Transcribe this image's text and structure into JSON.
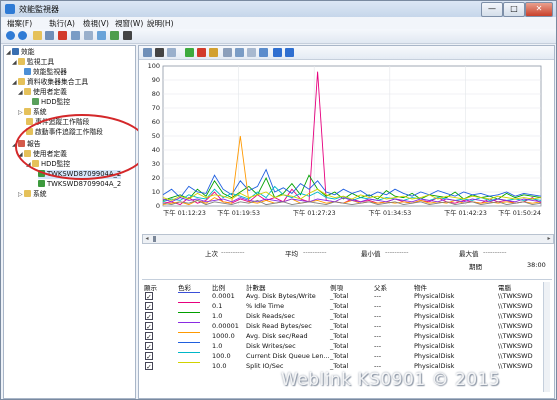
{
  "window": {
    "title": "效能監視器",
    "minimize": "—",
    "maximize": "□",
    "close": "✕"
  },
  "menu": [
    "檔案(F)",
    "執行(A)",
    "檢視(V)",
    "視窗(W)",
    "說明(H)"
  ],
  "tree": [
    {
      "label": "效能",
      "icon": "performance-icon",
      "color": "#3a6fb0"
    },
    {
      "label": "監視工具",
      "icon": "folder-icon",
      "color": "#e5c15a"
    },
    {
      "label": "效能監視器",
      "icon": "monitor-icon",
      "color": "#4c8fd6"
    },
    {
      "label": "資料收集器集合工具",
      "icon": "folder-icon",
      "color": "#e5c15a"
    },
    {
      "label": "使用者定義",
      "icon": "folder-icon",
      "color": "#e5c15a"
    },
    {
      "label": "HDD監控",
      "icon": "collector-icon",
      "color": "#5aa05a"
    },
    {
      "label": "系統",
      "icon": "folder-icon",
      "color": "#e5c15a"
    },
    {
      "label": "事件追蹤工作階段",
      "icon": "folder-icon",
      "color": "#e5c15a"
    },
    {
      "label": "啟動事件追蹤工作階段",
      "icon": "folder-icon",
      "color": "#e5c15a"
    },
    {
      "label": "報告",
      "icon": "report-icon",
      "color": "#d35a4a"
    },
    {
      "label": "使用者定義",
      "icon": "folder-icon",
      "color": "#e5c15a"
    },
    {
      "label": "HDD監控",
      "icon": "folder-icon",
      "color": "#e5c15a"
    },
    {
      "label": "TWKSWD8709904A_2",
      "icon": "report-file-icon",
      "color": "#3d9a3d"
    },
    {
      "label": "TWKSWD8709904A_2",
      "icon": "report-file-icon",
      "color": "#3d9a3d"
    },
    {
      "label": "系統",
      "icon": "folder-icon",
      "color": "#e5c15a"
    }
  ],
  "chart_data": {
    "type": "line",
    "y_ticks": [
      "100",
      "90",
      "80",
      "70",
      "60",
      "50",
      "40",
      "30",
      "20",
      "10",
      "0"
    ],
    "x_ticks": [
      "下午 01:12:23",
      "下午 01:19:53",
      "下午 01:27:23",
      "下午 01:34:53",
      "下午 01:42:23",
      "下午 01:50:24"
    ],
    "ylim": [
      0,
      100
    ],
    "series": [
      {
        "color": "#e6007e",
        "values": [
          2,
          3,
          1,
          6,
          2,
          4,
          10,
          3,
          2,
          5,
          3,
          8,
          4,
          6,
          3,
          12,
          5,
          3,
          96,
          4,
          3,
          2,
          5,
          3,
          4,
          2,
          3,
          5,
          3,
          2,
          4,
          3,
          6,
          3,
          2,
          4,
          3,
          2,
          5,
          3,
          4,
          2,
          3,
          6,
          2
        ]
      },
      {
        "color": "#00a000",
        "values": [
          4,
          6,
          8,
          5,
          12,
          7,
          18,
          9,
          6,
          10,
          14,
          8,
          20,
          6,
          9,
          16,
          8,
          22,
          12,
          7,
          10,
          5,
          9,
          6,
          8,
          5,
          11,
          7,
          6,
          9,
          5,
          8,
          7,
          6,
          10,
          5,
          8,
          6,
          7,
          5,
          9,
          6,
          8,
          7,
          6
        ]
      },
      {
        "color": "#1f5fe0",
        "values": [
          8,
          12,
          6,
          14,
          10,
          9,
          22,
          12,
          8,
          18,
          11,
          14,
          26,
          10,
          13,
          9,
          16,
          12,
          18,
          10,
          8,
          12,
          9,
          11,
          7,
          10,
          8,
          12,
          9,
          7,
          10,
          8,
          11,
          9,
          7,
          10,
          8,
          9,
          7,
          8,
          10,
          7,
          9,
          8,
          7
        ]
      },
      {
        "color": "#00b7c8",
        "values": [
          3,
          5,
          4,
          8,
          6,
          5,
          12,
          6,
          9,
          7,
          5,
          10,
          6,
          14,
          8,
          6,
          9,
          7,
          10,
          6,
          5,
          7,
          4,
          6,
          5,
          4,
          6,
          5,
          4,
          6,
          5,
          4,
          6,
          5,
          4,
          5,
          4,
          6,
          4,
          5,
          4,
          5,
          4,
          5,
          4
        ]
      },
      {
        "color": "#ff9900",
        "values": [
          1,
          2,
          3,
          1,
          4,
          2,
          6,
          3,
          2,
          50,
          3,
          2,
          4,
          2,
          3,
          5,
          2,
          3,
          4,
          2,
          3,
          2,
          4,
          2,
          3,
          2,
          3,
          2,
          3,
          2,
          4,
          2,
          3,
          2,
          4,
          2,
          3,
          2,
          3,
          2,
          3,
          2,
          3,
          2,
          3
        ]
      },
      {
        "color": "#8a2be2",
        "values": [
          5,
          3,
          6,
          4,
          5,
          3,
          4,
          5,
          3,
          6,
          4,
          3,
          5,
          4,
          3,
          5,
          4,
          3,
          5,
          4,
          3,
          6,
          4,
          3,
          5,
          4,
          3,
          5,
          4,
          3,
          5,
          4,
          3,
          5,
          4,
          3,
          5,
          4,
          3,
          5,
          4,
          3,
          5,
          4,
          3
        ]
      },
      {
        "color": "#d2d200",
        "values": [
          6,
          4,
          7,
          5,
          9,
          6,
          8,
          7,
          5,
          9,
          6,
          8,
          10,
          6,
          8,
          7,
          5,
          9,
          12,
          8,
          6,
          7,
          5,
          8,
          6,
          7,
          5,
          6,
          7,
          5,
          6,
          8,
          5,
          7,
          6,
          5,
          7,
          6,
          5,
          7,
          6,
          5,
          6,
          5,
          6
        ]
      },
      {
        "color": "#808080",
        "values": [
          2,
          1,
          3,
          2,
          4,
          1,
          3,
          2,
          1,
          3,
          2,
          4,
          1,
          2,
          3,
          1,
          2,
          3,
          2,
          1,
          3,
          2,
          1,
          2,
          3,
          1,
          2,
          3,
          1,
          2,
          3,
          1,
          2,
          3,
          1,
          2,
          3,
          1,
          2,
          3,
          1,
          2,
          3,
          1,
          2
        ]
      }
    ]
  },
  "stats": {
    "last_label": "上次",
    "last_value": "----------",
    "avg_label": "平均",
    "avg_value": "----------",
    "min_label": "最小值",
    "min_value": "----------",
    "max_label": "最大值",
    "max_value": "----------",
    "duration_label": "期間",
    "duration_value": "38:00"
  },
  "table": {
    "headers": {
      "show": "顯示",
      "color": "色彩",
      "scale": "比例",
      "counter": "計數器",
      "instance": "例項",
      "parent": "父系",
      "object": "物件",
      "computer": "電腦"
    },
    "rows": [
      {
        "check": "✓",
        "color": "#3a4fd8",
        "scale": "0.0001",
        "counter": "Avg. Disk Bytes/Write",
        "instance": "_Total",
        "parent": "---",
        "object": "PhysicalDisk",
        "computer": "\\\\TWKSWD"
      },
      {
        "check": "✓",
        "color": "#e6007e",
        "scale": "0.1",
        "counter": "% Idle Time",
        "instance": "_Total",
        "parent": "---",
        "object": "PhysicalDisk",
        "computer": "\\\\TWKSWD"
      },
      {
        "check": "✓",
        "color": "#00a000",
        "scale": "1.0",
        "counter": "Disk Reads/sec",
        "instance": "_Total",
        "parent": "---",
        "object": "PhysicalDisk",
        "computer": "\\\\TWKSWD"
      },
      {
        "check": "✓",
        "color": "#8a2be2",
        "scale": "0.00001",
        "counter": "Disk Read Bytes/sec",
        "instance": "_Total",
        "parent": "---",
        "object": "PhysicalDisk",
        "computer": "\\\\TWKSWD"
      },
      {
        "check": "✓",
        "color": "#ff9900",
        "scale": "1000.0",
        "counter": "Avg. Disk sec/Read",
        "instance": "_Total",
        "parent": "---",
        "object": "PhysicalDisk",
        "computer": "\\\\TWKSWD"
      },
      {
        "check": "✓",
        "color": "#1f5fe0",
        "scale": "1.0",
        "counter": "Disk Writes/sec",
        "instance": "_Total",
        "parent": "---",
        "object": "PhysicalDisk",
        "computer": "\\\\TWKSWD"
      },
      {
        "check": "✓",
        "color": "#00b7c8",
        "scale": "100.0",
        "counter": "Current Disk Queue Len...",
        "instance": "_Total",
        "parent": "---",
        "object": "PhysicalDisk",
        "computer": "\\\\TWKSWD"
      },
      {
        "check": "✓",
        "color": "#d2d200",
        "scale": "10.0",
        "counter": "Split IO/Sec",
        "instance": "_Total",
        "parent": "---",
        "object": "PhysicalDisk",
        "computer": "\\\\TWKSWD"
      }
    ]
  },
  "watermark": "Weblink KS0901 © 2015"
}
